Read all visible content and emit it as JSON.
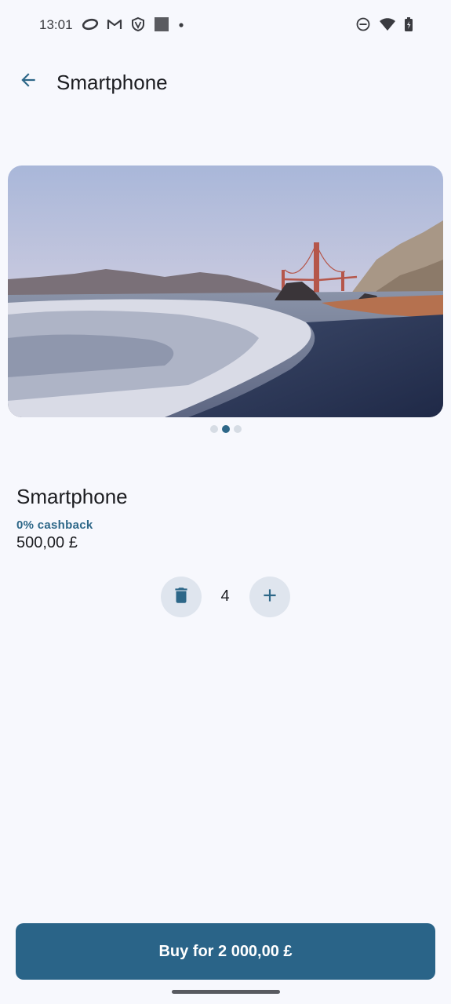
{
  "status_bar": {
    "time": "13:01",
    "left_icons": [
      "opera-icon",
      "gmail-icon",
      "vpn-shield-icon",
      "app-square-icon",
      "notification-dot-icon"
    ],
    "right_icons": [
      "do-not-disturb-icon",
      "wifi-icon",
      "battery-charging-icon"
    ]
  },
  "app_bar": {
    "back_icon": "arrow-back-icon",
    "title": "Smartphone"
  },
  "carousel": {
    "image_description": "beach-golden-gate-photo",
    "page_count": 3,
    "active_page": 2
  },
  "product": {
    "name": "Smartphone",
    "cashback": "0% cashback",
    "price": "500,00 £"
  },
  "quantity": {
    "value": "4",
    "delete_icon": "trash-icon",
    "add_icon": "plus-icon"
  },
  "buy_button": {
    "label": "Buy for 2 000,00 £"
  },
  "colors": {
    "accent": "#2a6488",
    "background": "#f7f8fd",
    "button_tonal": "#dfe5ee"
  }
}
